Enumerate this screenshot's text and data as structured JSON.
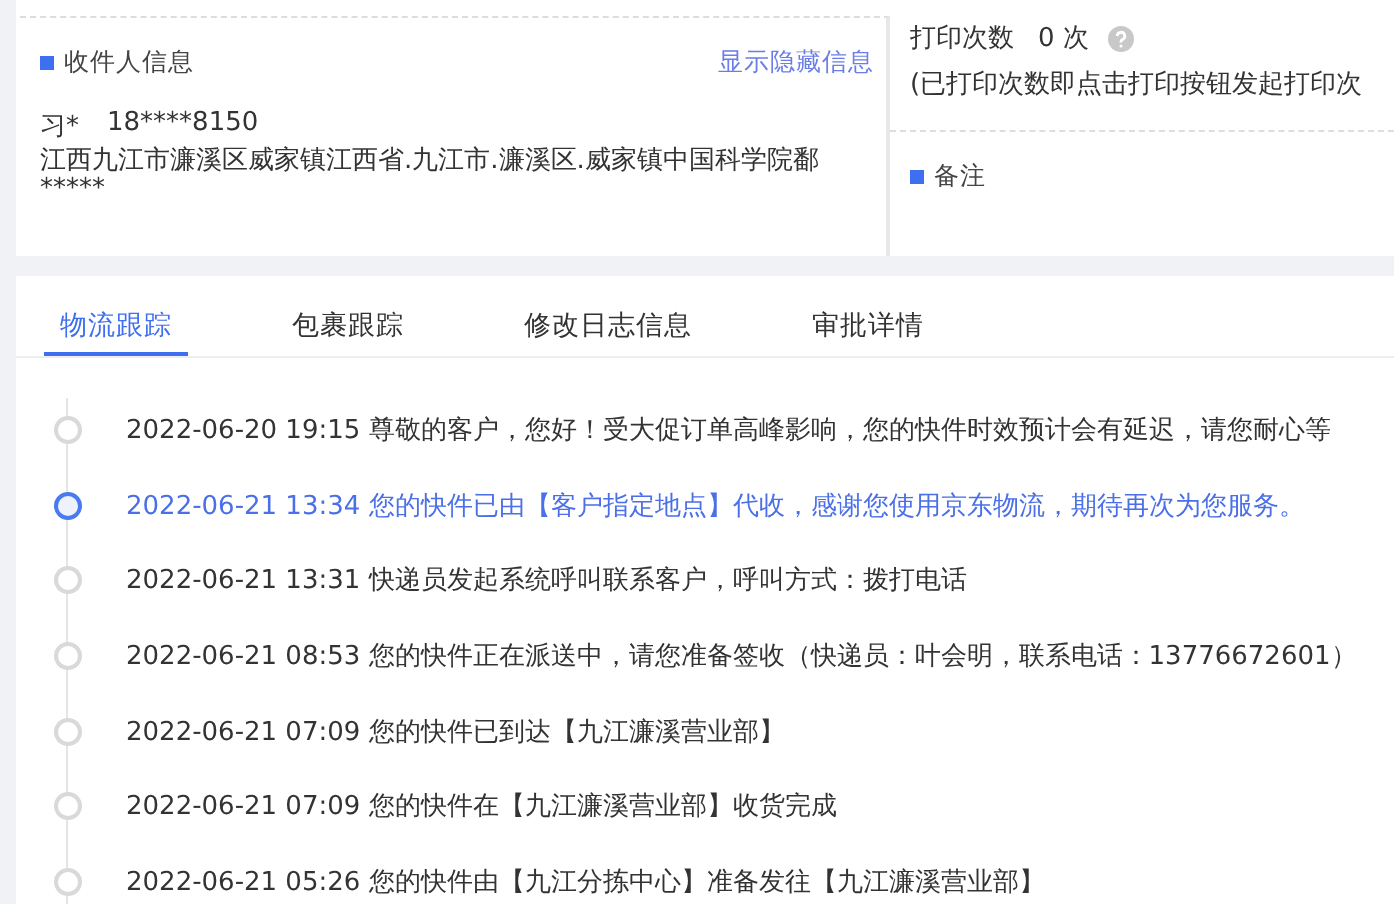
{
  "receiver": {
    "title": "收件人信息",
    "toggle_link": "显示隐藏信息",
    "name": "习*",
    "phone": "18****8150",
    "address": "江西九江市濂溪区威家镇江西省.九江市.濂溪区.威家镇中国科学院鄱*****"
  },
  "print": {
    "label": "打印次数",
    "count": "0 次",
    "note": "(已打印次数即点击打印按钮发起打印次"
  },
  "remarks": {
    "title": "备注"
  },
  "tabs": [
    {
      "label": "物流跟踪",
      "selected": true
    },
    {
      "label": "包裹跟踪",
      "selected": false
    },
    {
      "label": "修改日志信息",
      "selected": false
    },
    {
      "label": "审批详情",
      "selected": false
    }
  ],
  "events": [
    {
      "time": "2022-06-20 19:15",
      "text": "尊敬的客户，您好！受大促订单高峰影响，您的快件时效预计会有延迟，请您耐心等",
      "current": false
    },
    {
      "time": "2022-06-21 13:34",
      "text": "您的快件已由【客户指定地点】代收，感谢您使用京东物流，期待再次为您服务。",
      "current": true
    },
    {
      "time": "2022-06-21 13:31",
      "text": "快递员发起系统呼叫联系客户，呼叫方式：拨打电话",
      "current": false
    },
    {
      "time": "2022-06-21 08:53",
      "text": "您的快件正在派送中，请您准备签收（快递员：叶会明，联系电话：13776672601）",
      "current": false
    },
    {
      "time": "2022-06-21 07:09",
      "text": "您的快件已到达【九江濂溪营业部】",
      "current": false
    },
    {
      "time": "2022-06-21 07:09",
      "text": "您的快件在【九江濂溪营业部】收货完成",
      "current": false
    },
    {
      "time": "2022-06-21 05:26",
      "text": "您的快件由【九江分拣中心】准备发往【九江濂溪营业部】",
      "current": false
    }
  ]
}
